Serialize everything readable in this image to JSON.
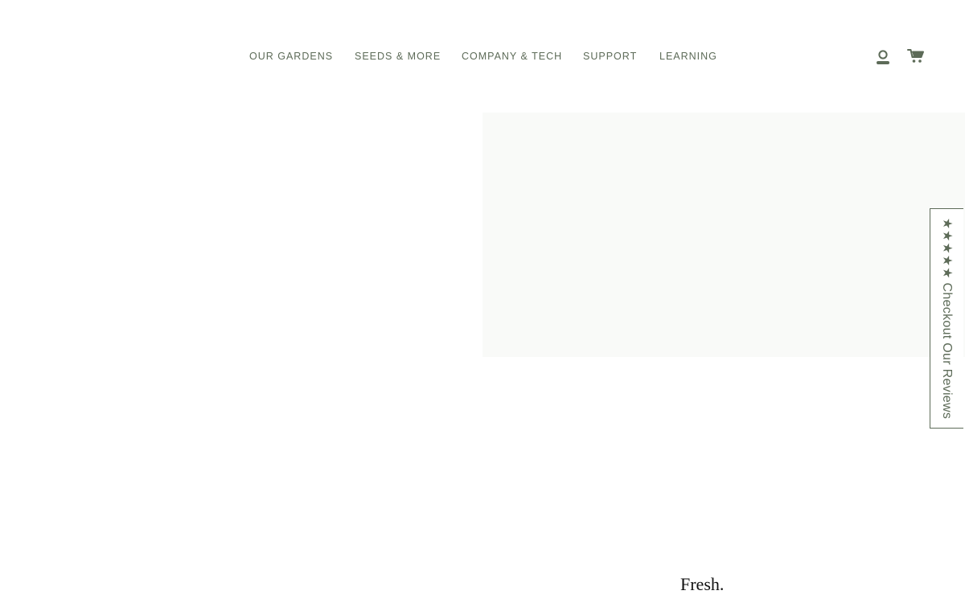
{
  "nav": {
    "items": [
      {
        "label": "OUR GARDENS"
      },
      {
        "label": "SEEDS & MORE"
      },
      {
        "label": "COMPANY & TECH"
      },
      {
        "label": "SUPPORT"
      },
      {
        "label": "LEARNING"
      }
    ],
    "account_icon": "account-icon",
    "cart_icon": "cart-icon"
  },
  "reviews_tab": {
    "stars": "★★★★★",
    "label": "Checkout Our Reviews"
  },
  "hero": {
    "heading": "Fresh."
  },
  "colors": {
    "accent": "#5d6b58",
    "panel": "#f9faf8"
  }
}
